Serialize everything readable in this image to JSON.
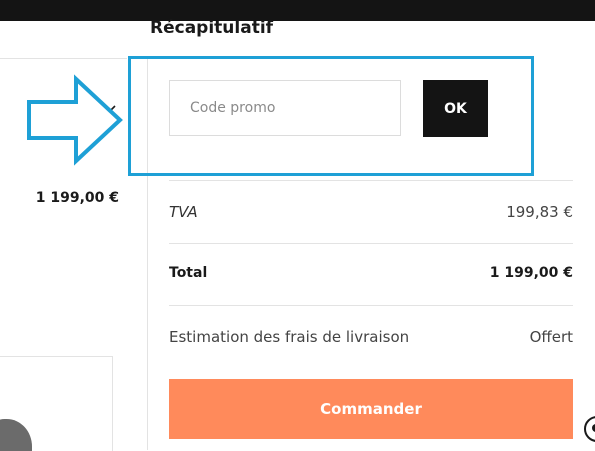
{
  "summary": {
    "title": "Récapitulatif",
    "promo": {
      "placeholder": "Code promo",
      "value": "",
      "button_label": "OK"
    },
    "rows": [
      {
        "label": "TVA",
        "value": "199,83 €"
      },
      {
        "label": "Total",
        "value": "1 199,00 €"
      },
      {
        "label": "Estimation des frais de livraison",
        "value": "Offert"
      }
    ],
    "order_button_label": "Commander"
  },
  "cart": {
    "item_price": "1 199,00 €",
    "remove_icon": "close-icon"
  },
  "annotation": {
    "arrow_icon": "arrow-right-icon",
    "color": "#1ea0d6"
  },
  "colors": {
    "accent_orange": "#ff8a5b",
    "dark": "#141414"
  }
}
